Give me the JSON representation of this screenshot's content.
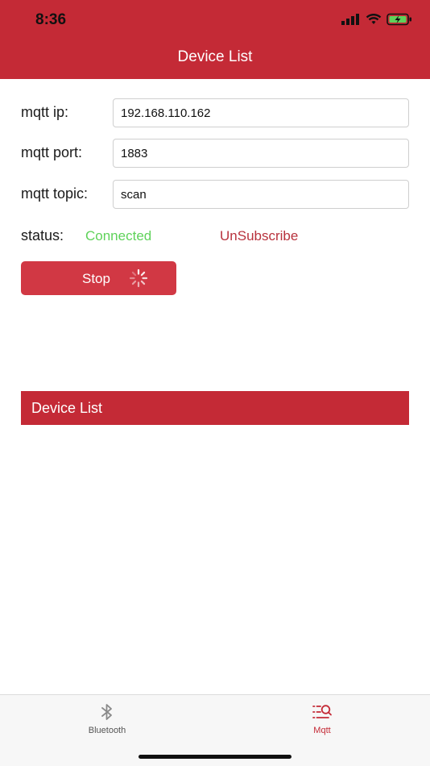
{
  "status_bar": {
    "time": "8:36"
  },
  "nav": {
    "title": "Device List"
  },
  "form": {
    "ip_label": "mqtt ip:",
    "ip_value": "192.168.110.162",
    "port_label": "mqtt port:",
    "port_value": "1883",
    "topic_label": "mqtt topic:",
    "topic_value": "scan"
  },
  "status": {
    "label": "status:",
    "value": "Connected",
    "value_color": "#5fd25a",
    "unsubscribe_label": "UnSubscribe"
  },
  "stop_button": {
    "label": "Stop",
    "icon": "spinner-icon"
  },
  "device_list": {
    "title": "Device List",
    "items": []
  },
  "tab_bar": {
    "tabs": [
      {
        "label": "Bluetooth",
        "icon": "bluetooth-icon",
        "active": false
      },
      {
        "label": "Mqtt",
        "icon": "mqtt-icon",
        "active": true
      }
    ]
  },
  "colors": {
    "brand": "#c42a36",
    "button": "#d13844",
    "link": "#b8323d"
  }
}
